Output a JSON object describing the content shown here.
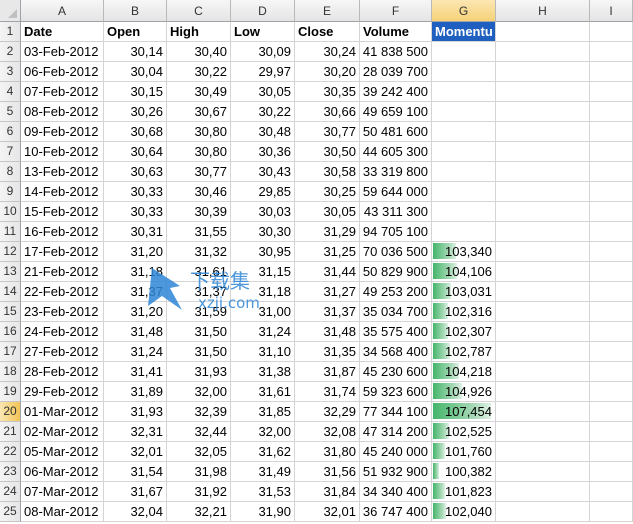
{
  "columns": [
    "A",
    "B",
    "C",
    "D",
    "E",
    "F",
    "G",
    "H",
    "I"
  ],
  "selected_row": 20,
  "selected_column": "G",
  "header_row": {
    "row": "1",
    "cells": [
      "Date",
      "Open",
      "High",
      "Low",
      "Close",
      "Volume",
      "Momentu"
    ]
  },
  "rows": [
    {
      "row": "2",
      "date": "03-Feb-2012",
      "open": "30,14",
      "high": "30,40",
      "low": "30,09",
      "close": "30,24",
      "volume": "41 838 500",
      "momentum": ""
    },
    {
      "row": "3",
      "date": "06-Feb-2012",
      "open": "30,04",
      "high": "30,22",
      "low": "29,97",
      "close": "30,20",
      "volume": "28 039 700",
      "momentum": ""
    },
    {
      "row": "4",
      "date": "07-Feb-2012",
      "open": "30,15",
      "high": "30,49",
      "low": "30,05",
      "close": "30,35",
      "volume": "39 242 400",
      "momentum": ""
    },
    {
      "row": "5",
      "date": "08-Feb-2012",
      "open": "30,26",
      "high": "30,67",
      "low": "30,22",
      "close": "30,66",
      "volume": "49 659 100",
      "momentum": ""
    },
    {
      "row": "6",
      "date": "09-Feb-2012",
      "open": "30,68",
      "high": "30,80",
      "low": "30,48",
      "close": "30,77",
      "volume": "50 481 600",
      "momentum": ""
    },
    {
      "row": "7",
      "date": "10-Feb-2012",
      "open": "30,64",
      "high": "30,80",
      "low": "30,36",
      "close": "30,50",
      "volume": "44 605 300",
      "momentum": ""
    },
    {
      "row": "8",
      "date": "13-Feb-2012",
      "open": "30,63",
      "high": "30,77",
      "low": "30,43",
      "close": "30,58",
      "volume": "33 319 800",
      "momentum": ""
    },
    {
      "row": "9",
      "date": "14-Feb-2012",
      "open": "30,33",
      "high": "30,46",
      "low": "29,85",
      "close": "30,25",
      "volume": "59 644 000",
      "momentum": ""
    },
    {
      "row": "10",
      "date": "15-Feb-2012",
      "open": "30,33",
      "high": "30,39",
      "low": "30,03",
      "close": "30,05",
      "volume": "43 311 300",
      "momentum": ""
    },
    {
      "row": "11",
      "date": "16-Feb-2012",
      "open": "30,31",
      "high": "31,55",
      "low": "30,30",
      "close": "31,29",
      "volume": "94 705 100",
      "momentum": ""
    },
    {
      "row": "12",
      "date": "17-Feb-2012",
      "open": "31,20",
      "high": "31,32",
      "low": "30,95",
      "close": "31,25",
      "volume": "70 036 500",
      "momentum": "103,340",
      "bar": 0.38
    },
    {
      "row": "13",
      "date": "21-Feb-2012",
      "open": "31,18",
      "high": "31,61",
      "low": "31,15",
      "close": "31,44",
      "volume": "50 829 900",
      "momentum": "104,106",
      "bar": 0.4
    },
    {
      "row": "14",
      "date": "22-Feb-2012",
      "open": "31,37",
      "high": "31,37",
      "low": "31,18",
      "close": "31,27",
      "volume": "49 253 200",
      "momentum": "103,031",
      "bar": 0.3
    },
    {
      "row": "15",
      "date": "23-Feb-2012",
      "open": "31,20",
      "high": "31,59",
      "low": "31,00",
      "close": "31,37",
      "volume": "35 034 700",
      "momentum": "102,316",
      "bar": 0.25
    },
    {
      "row": "16",
      "date": "24-Feb-2012",
      "open": "31,48",
      "high": "31,50",
      "low": "31,24",
      "close": "31,48",
      "volume": "35 575 400",
      "momentum": "102,307",
      "bar": 0.25
    },
    {
      "row": "17",
      "date": "27-Feb-2012",
      "open": "31,24",
      "high": "31,50",
      "low": "31,10",
      "close": "31,35",
      "volume": "34 568 400",
      "momentum": "102,787",
      "bar": 0.28
    },
    {
      "row": "18",
      "date": "28-Feb-2012",
      "open": "31,41",
      "high": "31,93",
      "low": "31,38",
      "close": "31,87",
      "volume": "45 230 600",
      "momentum": "104,218",
      "bar": 0.42
    },
    {
      "row": "19",
      "date": "29-Feb-2012",
      "open": "31,89",
      "high": "32,00",
      "low": "31,61",
      "close": "31,74",
      "volume": "59 323 600",
      "momentum": "104,926",
      "bar": 0.48
    },
    {
      "row": "20",
      "date": "01-Mar-2012",
      "open": "31,93",
      "high": "32,39",
      "low": "31,85",
      "close": "32,29",
      "volume": "77 344 100",
      "momentum": "107,454",
      "bar": 0.95
    },
    {
      "row": "21",
      "date": "02-Mar-2012",
      "open": "32,31",
      "high": "32,44",
      "low": "32,00",
      "close": "32,08",
      "volume": "47 314 200",
      "momentum": "102,525",
      "bar": 0.26
    },
    {
      "row": "22",
      "date": "05-Mar-2012",
      "open": "32,01",
      "high": "32,05",
      "low": "31,62",
      "close": "31,80",
      "volume": "45 240 000",
      "momentum": "101,760",
      "bar": 0.2
    },
    {
      "row": "23",
      "date": "06-Mar-2012",
      "open": "31,54",
      "high": "31,98",
      "low": "31,49",
      "close": "31,56",
      "volume": "51 932 900",
      "momentum": "100,382",
      "bar": 0.1
    },
    {
      "row": "24",
      "date": "07-Mar-2012",
      "open": "31,67",
      "high": "31,92",
      "low": "31,53",
      "close": "31,84",
      "volume": "34 340 400",
      "momentum": "101,823",
      "bar": 0.2
    },
    {
      "row": "25",
      "date": "08-Mar-2012",
      "open": "32,04",
      "high": "32,21",
      "low": "31,90",
      "close": "32,01",
      "volume": "36 747 400",
      "momentum": "102,040",
      "bar": 0.22
    }
  ],
  "watermark": {
    "text_top": "下载集",
    "text_bottom": "xzji.com"
  },
  "colors": {
    "bar_start": "#44b56a",
    "bar_end": "#dff2e6",
    "active_header": "#1f5fbf",
    "selection": "#f6d277"
  }
}
